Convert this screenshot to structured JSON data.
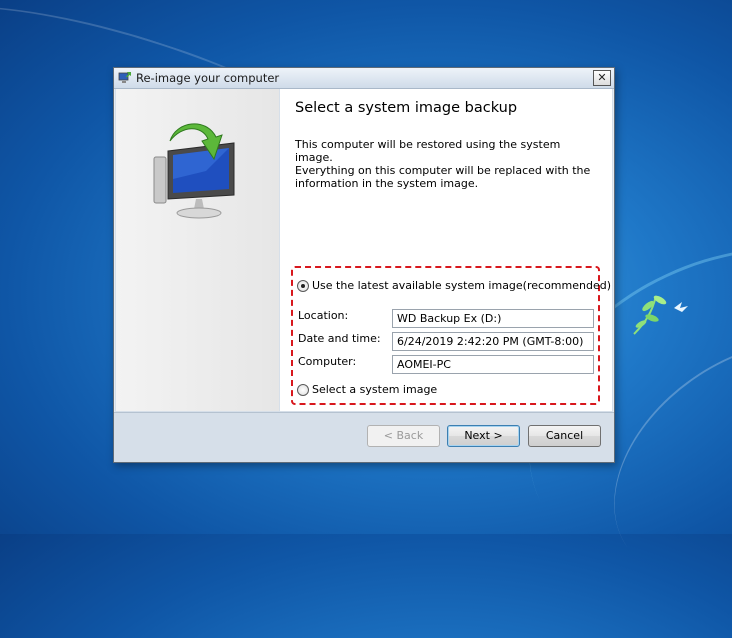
{
  "window": {
    "title": "Re-image your computer",
    "close_glyph": "✕"
  },
  "page": {
    "heading": "Select a system image backup",
    "description": "This computer will be restored using the system image.\nEverything on this computer will be replaced with the\ninformation in the system image."
  },
  "options": {
    "latest_label": "Use the latest available system image(recommended)",
    "latest_selected": true,
    "select_label": "Select a system image",
    "select_selected": false
  },
  "details": {
    "location_label": "Location:",
    "location_value": "WD Backup Ex  (D:)",
    "datetime_label": "Date and time:",
    "datetime_value": "6/24/2019 2:42:20 PM (GMT-8:00)",
    "computer_label": "Computer:",
    "computer_value": "AOMEI-PC"
  },
  "buttons": {
    "back": "< Back",
    "next": "Next >",
    "cancel": "Cancel"
  },
  "icons": {
    "title_icon": "restore-computer-icon",
    "hero_icon": "monitor-restore-arrow-icon",
    "desktop_logo": "bird-branch-logo"
  },
  "colors": {
    "highlight_border": "#d8171d",
    "arrow_green": "#5cb83a",
    "screen_blue": "#1f4fbf"
  }
}
